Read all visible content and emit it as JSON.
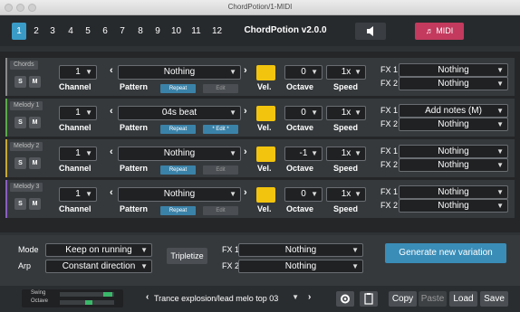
{
  "window": {
    "title": "ChordPotion/1-MIDI"
  },
  "tabs": [
    "1",
    "2",
    "3",
    "4",
    "5",
    "6",
    "7",
    "8",
    "9",
    "10",
    "11",
    "12"
  ],
  "selected_tab": "1",
  "version": "ChordPotion v2.0.0",
  "midi_button": "♬ MIDI",
  "labels": {
    "channel": "Channel",
    "pattern": "Pattern",
    "vel": "Vel.",
    "octave": "Octave",
    "speed": "Speed",
    "fx1": "FX 1",
    "fx2": "FX 2",
    "s": "S",
    "m": "M",
    "repeat": "Repeat",
    "edit": "Edit"
  },
  "tracks": [
    {
      "name": "Chords",
      "channel": "1",
      "pattern": "Nothing",
      "edit_label": "Edit",
      "edit_active": false,
      "octave": "0",
      "speed": "1x",
      "fx1": "Nothing",
      "fx2": "Nothing",
      "color": "#8a8a8a"
    },
    {
      "name": "Melody 1",
      "channel": "1",
      "pattern": "04s beat",
      "edit_label": "* Edit *",
      "edit_active": true,
      "octave": "0",
      "speed": "1x",
      "fx1": "Add notes (M)",
      "fx2": "Nothing",
      "color": "#5aa84a"
    },
    {
      "name": "Melody 2",
      "channel": "1",
      "pattern": "Nothing",
      "edit_label": "Edit",
      "edit_active": false,
      "octave": "-1",
      "speed": "1x",
      "fx1": "Nothing",
      "fx2": "Nothing",
      "color": "#c8a832"
    },
    {
      "name": "Melody 3",
      "channel": "1",
      "pattern": "Nothing",
      "edit_label": "Edit",
      "edit_active": false,
      "octave": "0",
      "speed": "1x",
      "fx1": "Nothing",
      "fx2": "Nothing",
      "color": "#8a5fc0"
    }
  ],
  "bottom": {
    "mode_label": "Mode",
    "mode_value": "Keep on running",
    "arp_label": "Arp",
    "arp_value": "Constant direction",
    "tripletize": "Tripletize",
    "fx1_label": "FX 1",
    "fx1_value": "Nothing",
    "fx2_label": "FX 2",
    "fx2_value": "Nothing",
    "generate": "Generate new variation"
  },
  "status": {
    "swing_label": "Swing",
    "octave_label": "Octave",
    "preset": "Trance explosion/lead melo top 03",
    "copy": "Copy",
    "paste": "Paste",
    "load": "Load",
    "save": "Save"
  }
}
